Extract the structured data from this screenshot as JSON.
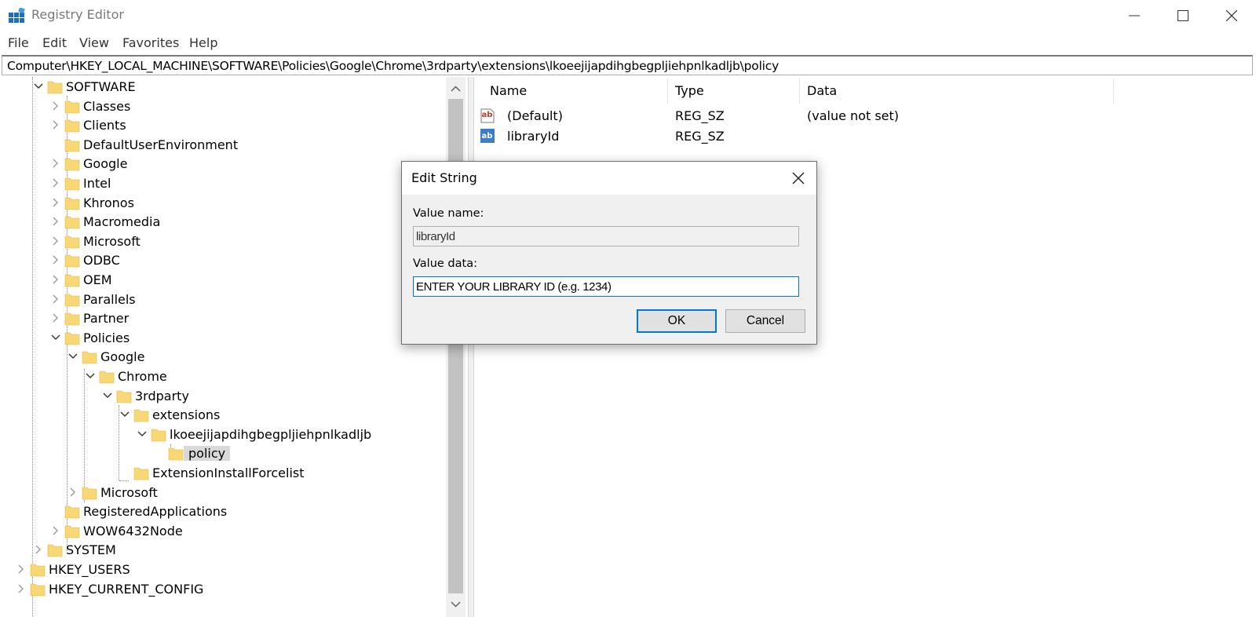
{
  "window": {
    "title": "Registry Editor"
  },
  "menu": {
    "items": [
      "File",
      "Edit",
      "View",
      "Favorites",
      "Help"
    ]
  },
  "address": {
    "path": "Computer\\HKEY_LOCAL_MACHINE\\SOFTWARE\\Policies\\Google\\Chrome\\3rdparty\\extensions\\lkoeejijapdihgbegpljiehpnlkadljb\\policy"
  },
  "tree": {
    "items": [
      {
        "label": "SOFTWARE",
        "state": "expanded"
      },
      {
        "label": "Classes",
        "state": "collapsed"
      },
      {
        "label": "Clients",
        "state": "collapsed"
      },
      {
        "label": "DefaultUserEnvironment",
        "state": "leaf"
      },
      {
        "label": "Google",
        "state": "collapsed"
      },
      {
        "label": "Intel",
        "state": "collapsed"
      },
      {
        "label": "Khronos",
        "state": "collapsed"
      },
      {
        "label": "Macromedia",
        "state": "collapsed"
      },
      {
        "label": "Microsoft",
        "state": "collapsed"
      },
      {
        "label": "ODBC",
        "state": "collapsed"
      },
      {
        "label": "OEM",
        "state": "collapsed"
      },
      {
        "label": "Parallels",
        "state": "collapsed"
      },
      {
        "label": "Partner",
        "state": "collapsed"
      },
      {
        "label": "Policies",
        "state": "expanded"
      },
      {
        "label": "Google",
        "state": "expanded"
      },
      {
        "label": "Chrome",
        "state": "expanded"
      },
      {
        "label": "3rdparty",
        "state": "expanded"
      },
      {
        "label": "extensions",
        "state": "expanded"
      },
      {
        "label": "lkoeejijapdihgbegpljiehpnlkadljb",
        "state": "expanded"
      },
      {
        "label": "policy",
        "state": "selected"
      },
      {
        "label": "ExtensionInstallForcelist",
        "state": "leaf"
      },
      {
        "label": "Microsoft",
        "state": "collapsed"
      },
      {
        "label": "RegisteredApplications",
        "state": "leaf"
      },
      {
        "label": "WOW6432Node",
        "state": "collapsed"
      },
      {
        "label": "SYSTEM",
        "state": "collapsed"
      },
      {
        "label": "HKEY_USERS",
        "state": "collapsed"
      },
      {
        "label": "HKEY_CURRENT_CONFIG",
        "state": "collapsed"
      }
    ]
  },
  "values": {
    "columns": [
      "Name",
      "Type",
      "Data"
    ],
    "rows": [
      {
        "name": "(Default)",
        "type": "REG_SZ",
        "data": "(value not set)"
      },
      {
        "name": "libraryId",
        "type": "REG_SZ",
        "data": ""
      }
    ]
  },
  "dialog": {
    "title": "Edit String",
    "value_name_label": "Value name:",
    "value_name": "libraryId",
    "value_data_label": "Value data:",
    "value_data": "ENTER YOUR LIBRARY ID (e.g. 1234)",
    "ok_label": "OK",
    "cancel_label": "Cancel"
  },
  "colors": {
    "accent": "#0078d7",
    "folder": "#f8d775",
    "selection": "#d9d9d9"
  }
}
